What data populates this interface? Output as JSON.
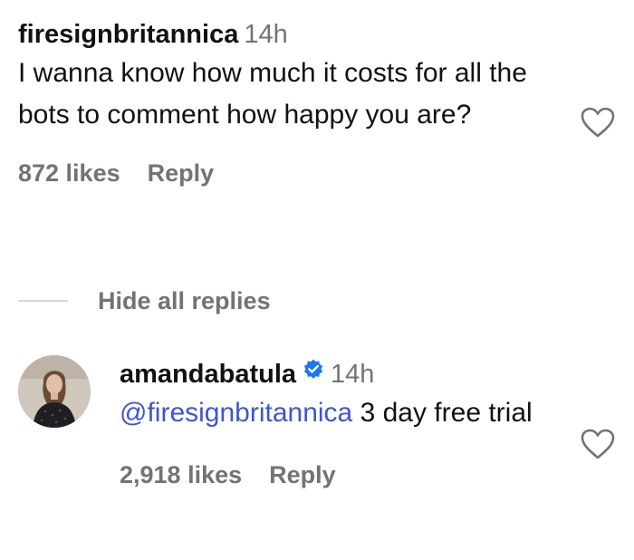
{
  "comment": {
    "username": "firesignbritannica",
    "time": "14h",
    "text": "I wanna know how much it costs for all the bots to comment how happy you are?",
    "likes": "872 likes",
    "reply_label": "Reply",
    "like_icon": "heart-outline-icon"
  },
  "replies_toggle": {
    "label": "Hide all replies"
  },
  "reply": {
    "username": "amandabatula",
    "verified": true,
    "verified_icon": "verified-badge-icon",
    "time": "14h",
    "mention": "@firesignbritannica",
    "text": " 3 day free trial",
    "likes": "2,918 likes",
    "reply_label": "Reply",
    "like_icon": "heart-outline-icon"
  },
  "colors": {
    "secondary_text": "#737373",
    "mention": "#3e55d6",
    "verified_badge": "#1877f2",
    "divider": "#d6d6d6"
  }
}
